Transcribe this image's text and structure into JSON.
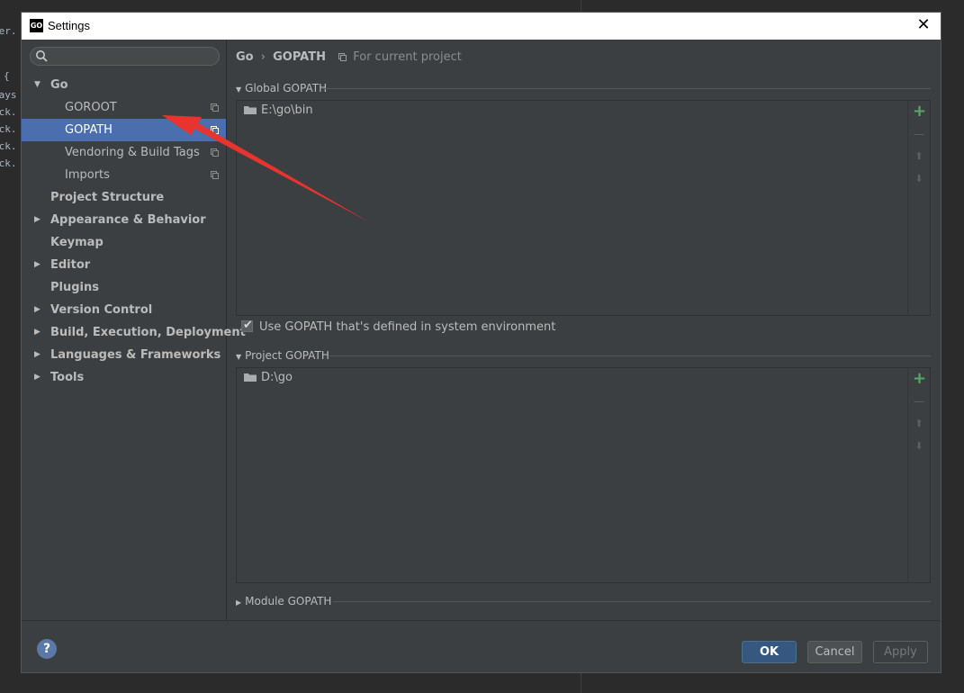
{
  "background_code": [
    " {",
    "hays",
    "ack.",
    "ack.",
    "ack.",
    "ack.",
    "ker."
  ],
  "window": {
    "title": "Settings",
    "close_glyph": "✕",
    "app_icon_text": "GO"
  },
  "sidebar": {
    "search": {
      "placeholder": "",
      "value": ""
    },
    "items": [
      {
        "label": "Go",
        "bold": true,
        "expandable": true,
        "expanded": true,
        "level": 0
      },
      {
        "label": "GOROOT",
        "level": 1,
        "project_scoped": true
      },
      {
        "label": "GOPATH",
        "level": 1,
        "project_scoped": true,
        "selected": true
      },
      {
        "label": "Vendoring & Build Tags",
        "level": 1,
        "project_scoped": true
      },
      {
        "label": "Imports",
        "level": 1,
        "project_scoped": true
      },
      {
        "label": "Project Structure",
        "bold": true,
        "expandable": false,
        "level": 0
      },
      {
        "label": "Appearance & Behavior",
        "bold": true,
        "expandable": true,
        "level": 0
      },
      {
        "label": "Keymap",
        "bold": true,
        "expandable": false,
        "level": 0
      },
      {
        "label": "Editor",
        "bold": true,
        "expandable": true,
        "level": 0
      },
      {
        "label": "Plugins",
        "bold": true,
        "expandable": false,
        "level": 0
      },
      {
        "label": "Version Control",
        "bold": true,
        "expandable": true,
        "level": 0
      },
      {
        "label": "Build, Execution, Deployment",
        "bold": true,
        "expandable": true,
        "level": 0
      },
      {
        "label": "Languages & Frameworks",
        "bold": true,
        "expandable": true,
        "level": 0
      },
      {
        "label": "Tools",
        "bold": true,
        "expandable": true,
        "level": 0
      }
    ]
  },
  "breadcrumb": {
    "parent": "Go",
    "separator": "›",
    "current": "GOPATH",
    "scope": "For current project"
  },
  "global_gopath": {
    "title": "Global GOPATH",
    "entries": [
      "E:\\go\\bin"
    ],
    "use_system_env": {
      "label": "Use GOPATH that's defined in system environment",
      "checked": true
    }
  },
  "project_gopath": {
    "title": "Project GOPATH",
    "entries": [
      "D:\\go"
    ]
  },
  "module_gopath": {
    "title": "Module GOPATH"
  },
  "list_tools": {
    "add": "+",
    "remove": "—",
    "up": "⬆",
    "down": "⬇"
  },
  "footer": {
    "help": "?",
    "ok": "OK",
    "cancel": "Cancel",
    "apply": "Apply"
  },
  "colors": {
    "selection": "#4b6eaf",
    "add_green": "#59a869",
    "annotation_arrow": "#e8342f"
  }
}
